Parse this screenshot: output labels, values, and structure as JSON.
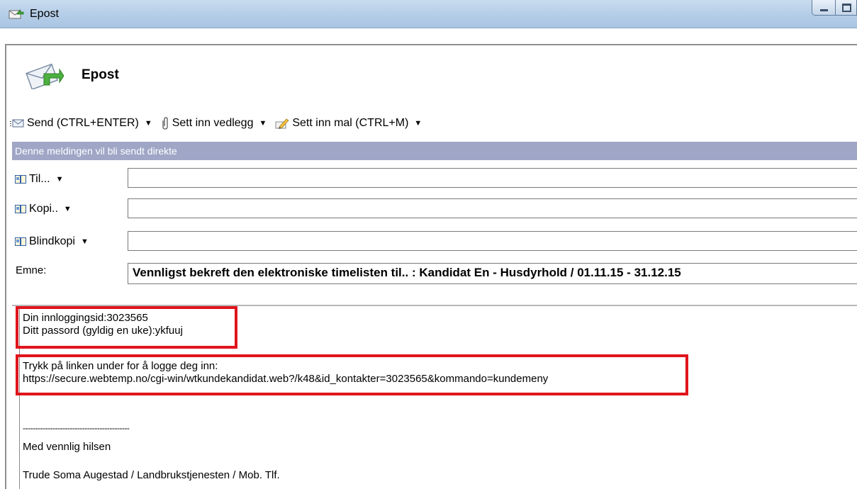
{
  "window": {
    "title": "Epost",
    "icon": "email-app-icon",
    "buttons": [
      "minimize",
      "maximize"
    ]
  },
  "header": {
    "title": "Epost",
    "icon": "envelope-arrow-icon"
  },
  "toolbar": {
    "send_label": "Send (CTRL+ENTER)",
    "attach_label": "Sett inn vedlegg",
    "template_label": "Sett inn mal (CTRL+M)"
  },
  "infobar": {
    "text": "Denne meldingen vil bli sendt direkte",
    "background": "#9fa6c6"
  },
  "recipients": {
    "to_label": "Til...",
    "to_value": "",
    "cc_label": "Kopi..",
    "cc_value": "",
    "bcc_label": "Blindkopi",
    "bcc_value": ""
  },
  "subject": {
    "label": "Emne:",
    "value": "Vennligst bekreft den elektroniske timelisten til.. : Kandidat En - Husdyrhold / 01.11.15 - 31.12.15"
  },
  "body": {
    "lines": [
      "Din innloggingsid:3023565",
      "Ditt passord (gyldig en uke):ykfuuj",
      "Trykk på linken under for å logge deg inn:",
      "https://secure.webtemp.no/cgi-win/wtkundekandidat.web?/k48&id_kontakter=3023565&kommando=kundemeny",
      "-------------------------------------------",
      "Med vennlig hilsen",
      "Trude Soma Augestad / Landbrukstjenesten / Mob. Tlf."
    ]
  },
  "colors": {
    "highlight": "#e0141c",
    "titlebar": "#b7cfe8"
  }
}
